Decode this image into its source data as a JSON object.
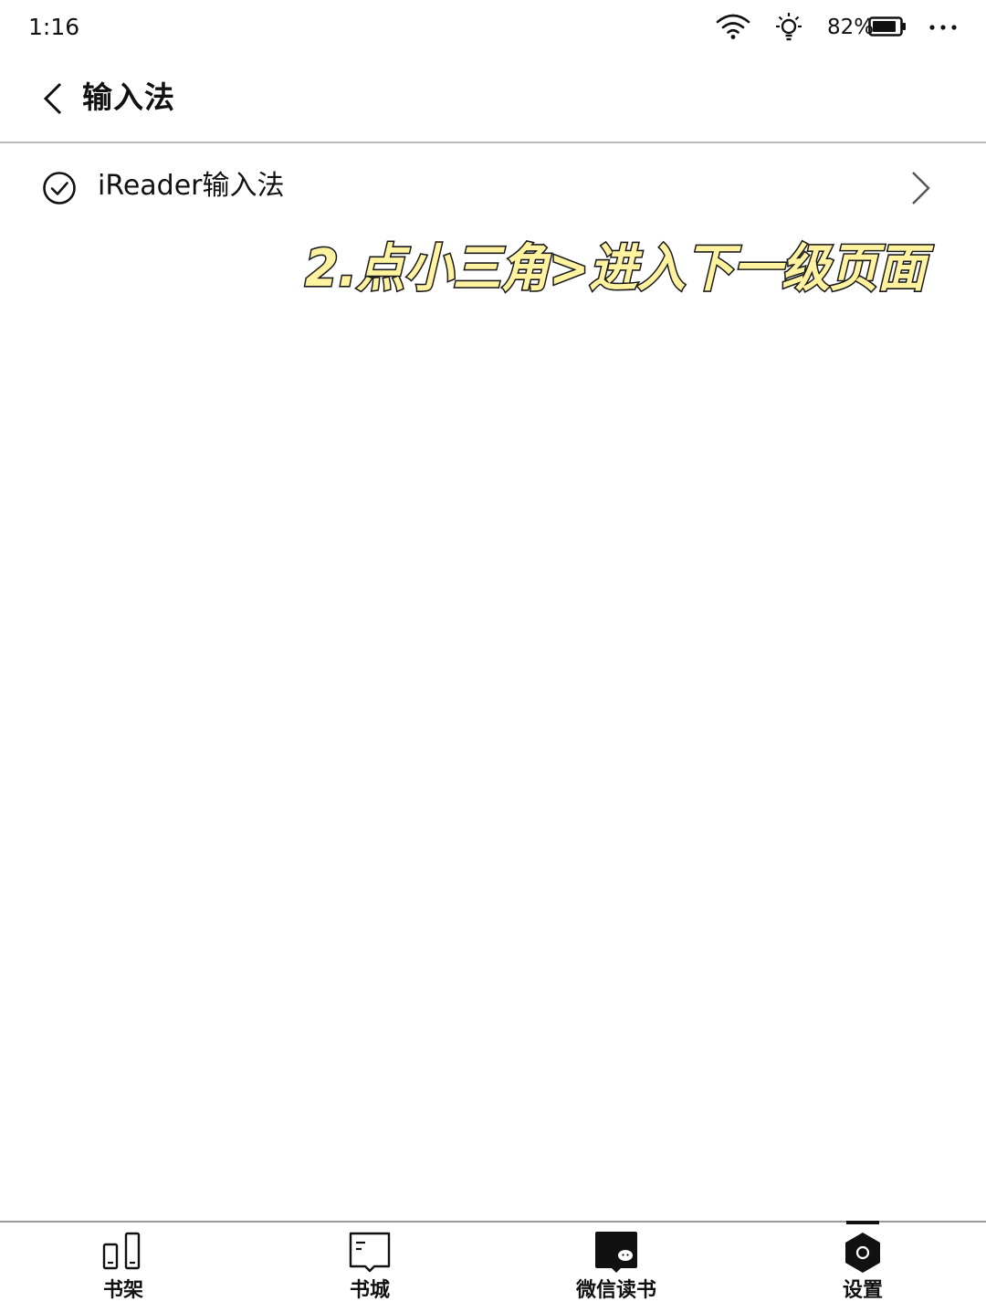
{
  "status_bar": {
    "time": "1:16",
    "battery": "82%",
    "icons": [
      "wifi-icon",
      "light-icon",
      "battery-icon",
      "more-icon"
    ]
  },
  "header": {
    "title": "输入法",
    "back_icon": "chevron-left-icon"
  },
  "list": {
    "items": [
      {
        "label": "iReader输入法",
        "checked": true,
        "icon": "check-circle-icon",
        "trailing_icon": "chevron-right-icon"
      }
    ]
  },
  "annotation": {
    "text": "2.点小三角>进入下一级页面",
    "fill_color": "#fff3a0",
    "stroke_color": "#1a1a1a"
  },
  "bottom_nav": {
    "items": [
      {
        "label": "书架",
        "icon": "bookshelf-icon",
        "active": false
      },
      {
        "label": "书城",
        "icon": "bookstore-icon",
        "active": false
      },
      {
        "label": "微信读书",
        "icon": "wechat-read-icon",
        "active": false
      },
      {
        "label": "设置",
        "icon": "settings-icon",
        "active": true
      }
    ]
  }
}
